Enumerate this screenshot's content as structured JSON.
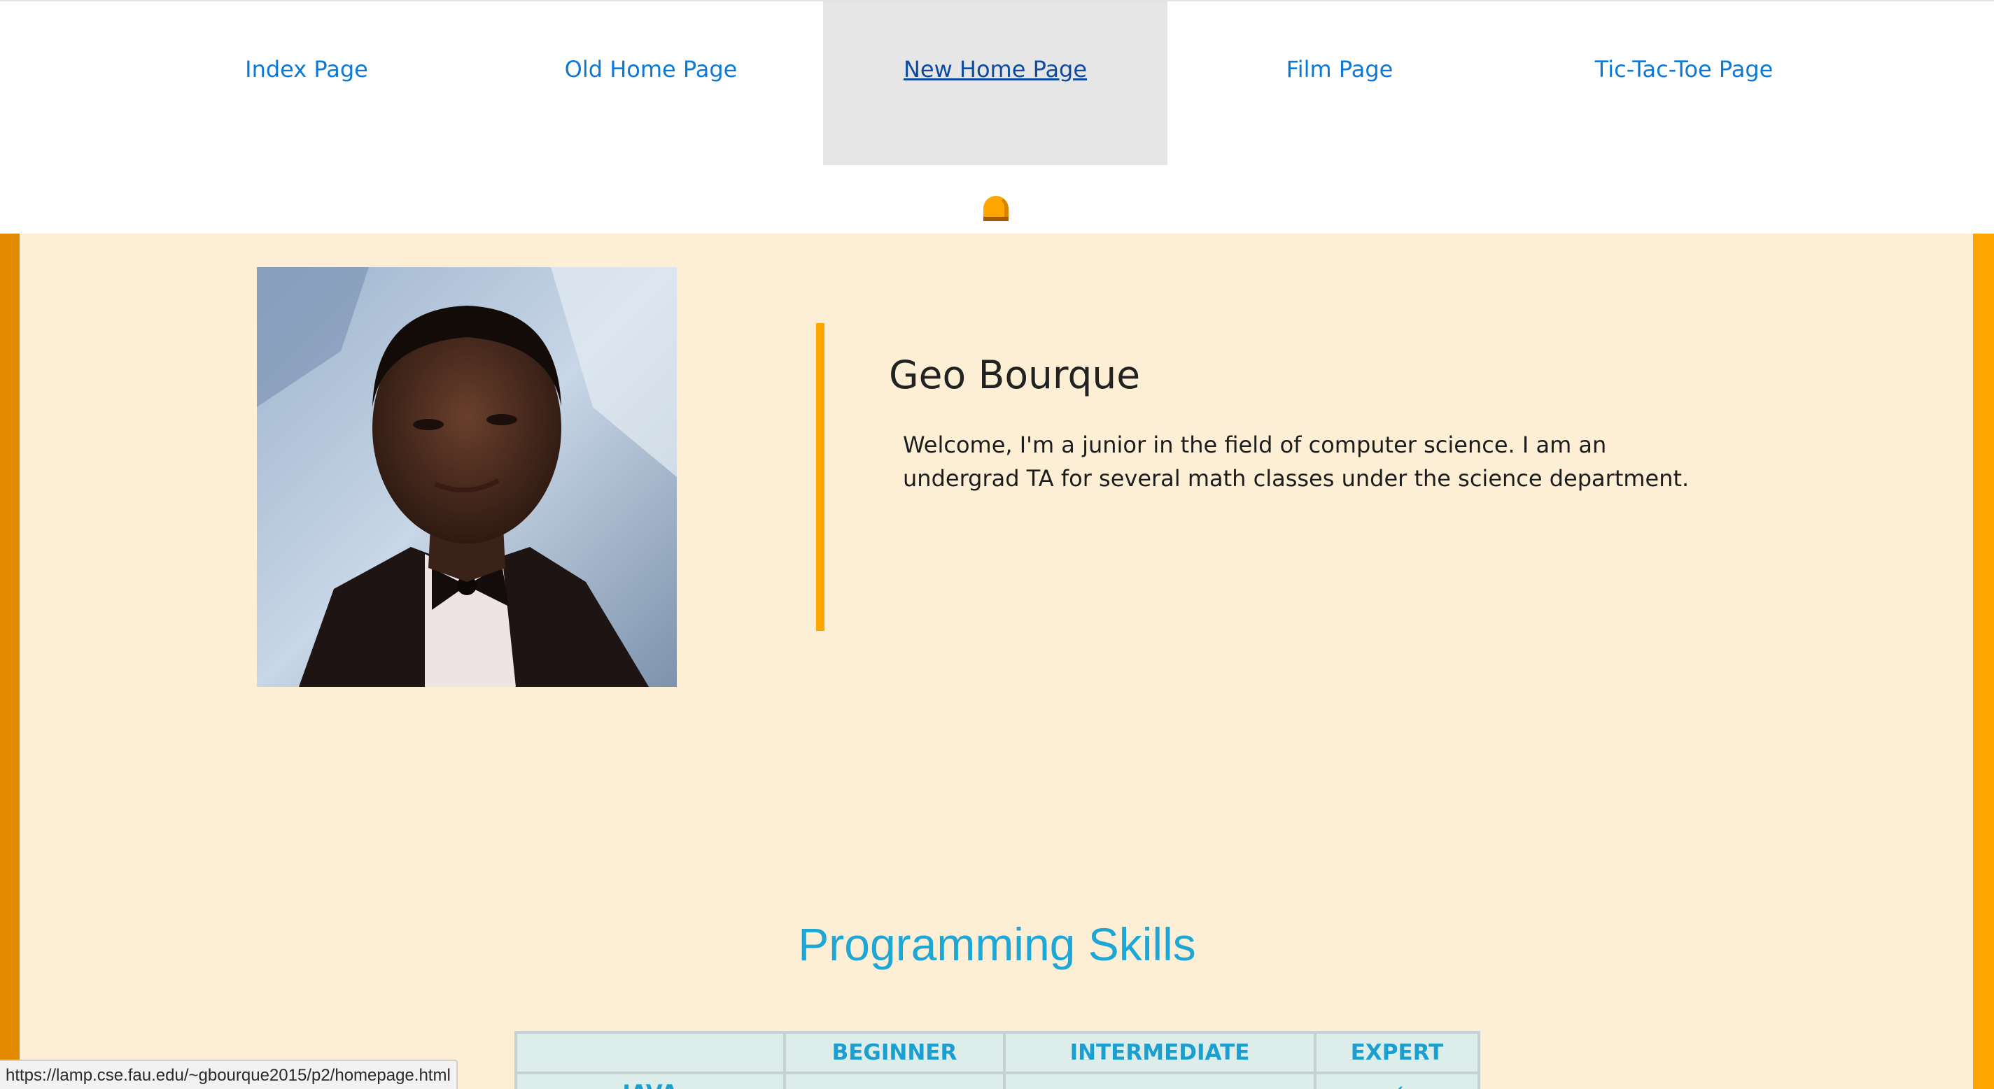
{
  "nav": {
    "links": [
      {
        "label": "Index Page"
      },
      {
        "label": "Old Home Page"
      },
      {
        "label": "New Home Page"
      },
      {
        "label": "Film Page"
      },
      {
        "label": "Tic-Tac-Toe Page"
      }
    ],
    "active_index": 2,
    "marker_icon": "orange-dome-icon"
  },
  "profile": {
    "photo_icon": "portrait-photo",
    "name": "Geo Bourque",
    "bio": "Welcome, I'm a junior in the field of computer science. I am an undergrad TA for several math classes under the science department."
  },
  "skills": {
    "title": "Programming Skills",
    "columns": [
      "",
      "BEGINNER",
      "INTERMEDIATE",
      "EXPERT"
    ],
    "rows": [
      {
        "label": "JAVA",
        "level": "EXPERT",
        "mark": "✓"
      }
    ]
  },
  "status_bar": {
    "url": "https://lamp.cse.fau.edu/~gbourque2015/p2/homepage.html"
  },
  "colors": {
    "accent": "#ffa500",
    "link": "#0c79d6",
    "heading": "#1ea6d5",
    "background": "#fdefd6"
  }
}
